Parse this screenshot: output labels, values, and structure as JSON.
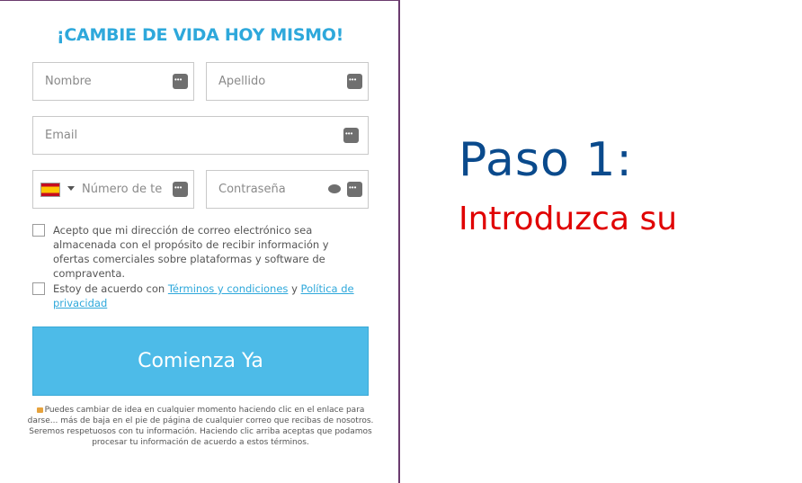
{
  "form": {
    "headline": "¡CAMBIE DE VIDA HOY MISMO!",
    "fields": {
      "nombre": {
        "placeholder": "Nombre",
        "value": ""
      },
      "apellido": {
        "placeholder": "Apellido",
        "value": ""
      },
      "email": {
        "placeholder": "Email",
        "value": ""
      },
      "telefono": {
        "placeholder": "Número de teléfono",
        "value": "",
        "country": "ES"
      },
      "contrasena": {
        "placeholder": "Contraseña",
        "value": ""
      }
    },
    "consent1": "Acepto que mi dirección de correo electrónico sea almacenada con el propósito de recibir información y ofertas comerciales sobre plataformas y software de compraventa.",
    "consent2": {
      "prefix": "Estoy de acuerdo con",
      "terms_link": "Términos y condiciones",
      "and": "y",
      "privacy_link": "Política de privacidad"
    },
    "submit_label": "Comienza Ya",
    "fineprint": "Puedes cambiar de idea en cualquier momento haciendo clic en el enlace para darse... más de baja en el pie de página de cualquier correo que recibas de nosotros. Seremos respetuosos con tu información. Haciendo clic arriba aceptas que podamos procesar tu información de acuerdo a estos términos."
  },
  "aside": {
    "step_title": "Paso 1:",
    "step_text": "Introduzca su"
  },
  "colors": {
    "accent": "#2ea8db",
    "button": "#4dbbe8",
    "step_title": "#0a4a8c",
    "step_text": "#e00000"
  },
  "icons": [
    "key-dots-icon",
    "spain-flag-icon",
    "dropdown-caret-icon",
    "eye-icon",
    "lock-icon"
  ]
}
